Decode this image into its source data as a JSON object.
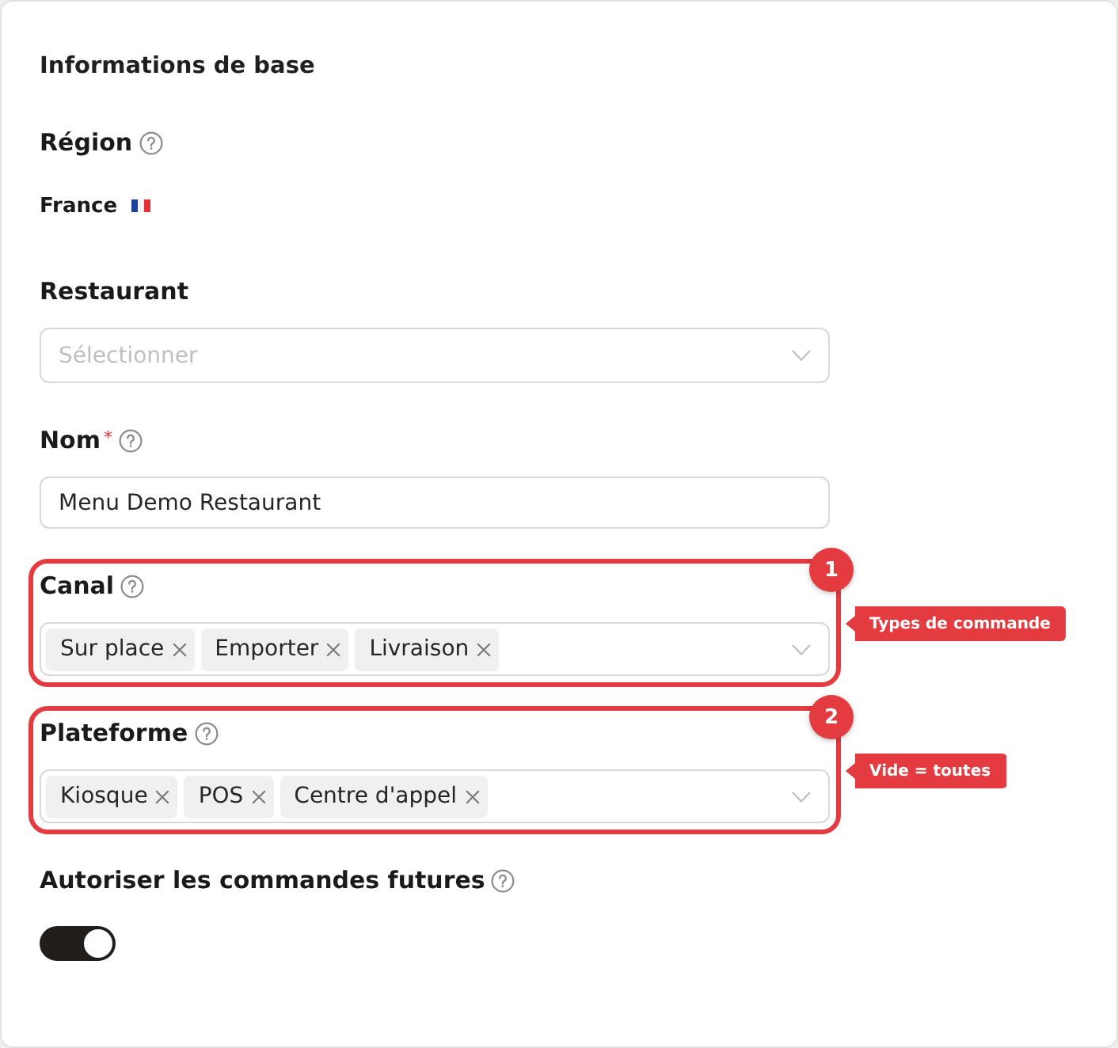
{
  "section": {
    "title": "Informations de base"
  },
  "fields": [
    {
      "kind": "static",
      "label": "Région",
      "help": true,
      "value": "France"
    },
    {
      "kind": "select",
      "label": "Restaurant",
      "help": false,
      "placeholder": "Sélectionner"
    },
    {
      "kind": "text",
      "label": "Nom",
      "required_mark": "*",
      "help": true,
      "value": "Menu Demo Restaurant"
    },
    {
      "kind": "tags",
      "label": "Canal",
      "help": true,
      "tags": [
        "Sur place",
        "Emporter",
        "Livraison"
      ],
      "annotation": {
        "number": "1",
        "note": "Types de commande"
      }
    },
    {
      "kind": "tags",
      "label": "Plateforme",
      "help": true,
      "tags": [
        "Kiosque",
        "POS",
        "Centre d'appel"
      ],
      "annotation": {
        "number": "2",
        "note": "Vide = toutes"
      }
    },
    {
      "kind": "toggle",
      "label": "Autoriser les commandes futures",
      "help": true,
      "on": true
    }
  ]
}
